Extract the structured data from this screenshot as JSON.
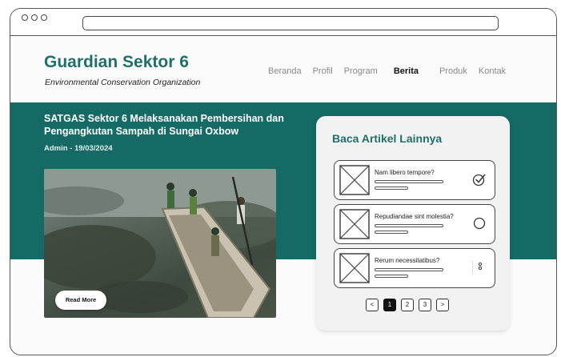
{
  "site": {
    "brand": "Guardian Sektor 6",
    "tagline": "Environmental Conservation Organization"
  },
  "nav": [
    {
      "label": "Beranda",
      "active": false
    },
    {
      "label": "Profil",
      "active": false
    },
    {
      "label": "Program",
      "active": false
    },
    {
      "label": "Berita",
      "active": true
    },
    {
      "label": "Produk",
      "active": false
    },
    {
      "label": "Kontak",
      "active": false
    }
  ],
  "article": {
    "headline": "SATGAS Sektor 6 Melaksanakan Pembersihan dan Pengangkutan Sampah di Sungai Oxbow",
    "meta": "Admin - 19/03/2024",
    "read_more": "Read More"
  },
  "sidebar": {
    "title": "Baca Artikel Lainnya",
    "cards": [
      {
        "title": "Nam libero tempore?",
        "icon": "check-circle-icon"
      },
      {
        "title": "Repudiandae sint molestia?",
        "icon": "circle-icon"
      },
      {
        "title": "Rerum necessitatibus?",
        "icon": "dots-vertical-icon"
      }
    ],
    "pager": {
      "prev": "<",
      "pages": [
        "1",
        "2",
        "3"
      ],
      "current": "1",
      "next": ">"
    }
  },
  "colors": {
    "accent": "#156a65",
    "brand": "#1f6f6a"
  }
}
